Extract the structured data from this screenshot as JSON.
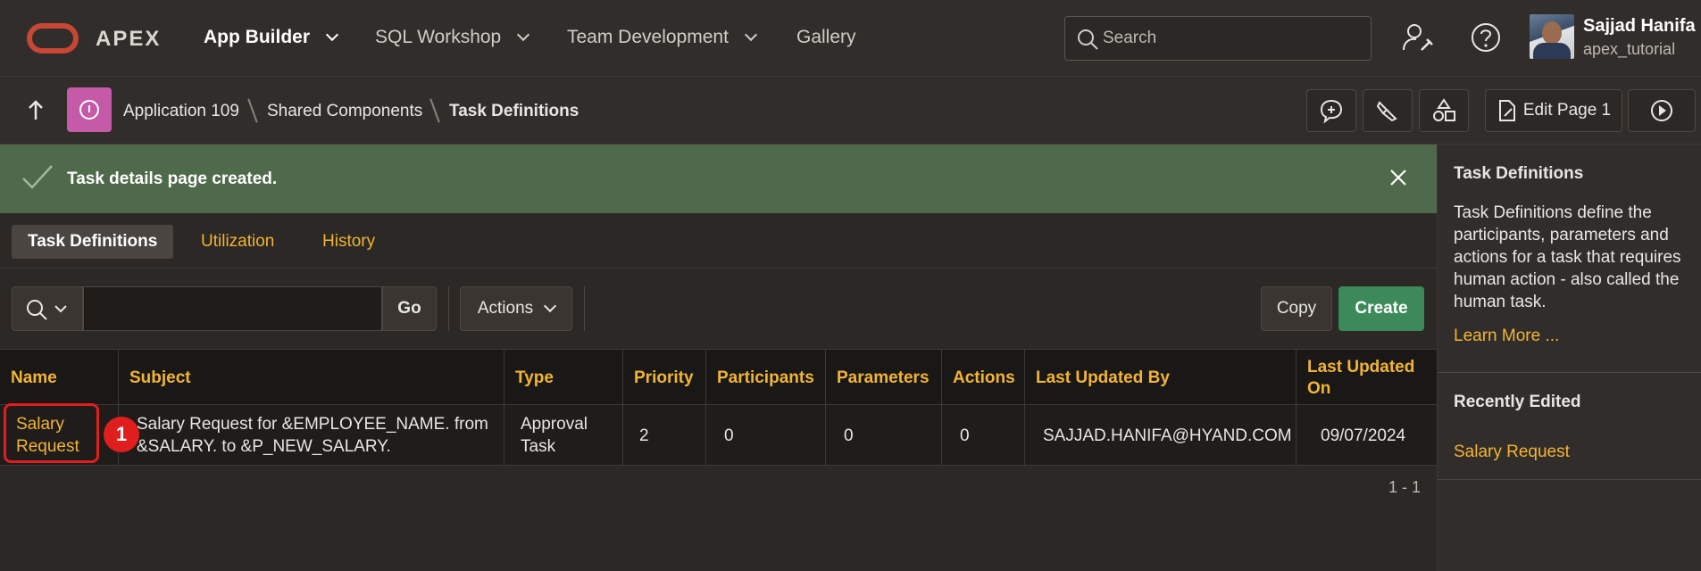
{
  "header": {
    "brand": "APEX",
    "nav": [
      {
        "label": "App Builder",
        "has_menu": true
      },
      {
        "label": "SQL Workshop",
        "has_menu": true
      },
      {
        "label": "Team Development",
        "has_menu": true
      },
      {
        "label": "Gallery",
        "has_menu": false
      }
    ],
    "search_placeholder": "Search",
    "user": {
      "name": "Sajjad Hanifa",
      "workspace": "apex_tutorial"
    }
  },
  "breadcrumb": {
    "items": [
      "Application 109",
      "Shared Components",
      "Task Definitions"
    ],
    "edit_page_label": "Edit Page 1"
  },
  "alert": {
    "message": "Task details page created."
  },
  "tabs": [
    {
      "label": "Task Definitions",
      "active": true
    },
    {
      "label": "Utilization",
      "active": false
    },
    {
      "label": "History",
      "active": false
    }
  ],
  "toolbar": {
    "go_label": "Go",
    "actions_label": "Actions",
    "copy_label": "Copy",
    "create_label": "Create",
    "search_value": ""
  },
  "table": {
    "columns": [
      "Name",
      "Subject",
      "Type",
      "Priority",
      "Participants",
      "Parameters",
      "Actions",
      "Last Updated By",
      "Last Updated On"
    ],
    "rows": [
      {
        "name": "Salary Request",
        "subject": "Salary Request for &EMPLOYEE_NAME. from &SALARY. to &P_NEW_SALARY.",
        "type": "Approval Task",
        "priority": "2",
        "participants": "0",
        "parameters": "0",
        "actions": "0",
        "last_updated_by": "SAJJAD.HANIFA@HYAND.COM",
        "last_updated_on": "09/07/2024"
      }
    ],
    "pagination": "1 - 1"
  },
  "annotation": {
    "step": "1"
  },
  "side_panel": {
    "title": "Task Definitions",
    "description": "Task Definitions define the participants, parameters and actions for a task that requires human action - also called the human task.",
    "learn_more": "Learn More ...",
    "recent_title": "Recently Edited",
    "recent_items": [
      "Salary Request"
    ]
  },
  "colors": {
    "accent_link": "#f2b434",
    "success_banner": "#4f6a4a",
    "create_button": "#3c8a5a",
    "oracle_red": "#c74634",
    "annotation_red": "#e01e1e"
  }
}
